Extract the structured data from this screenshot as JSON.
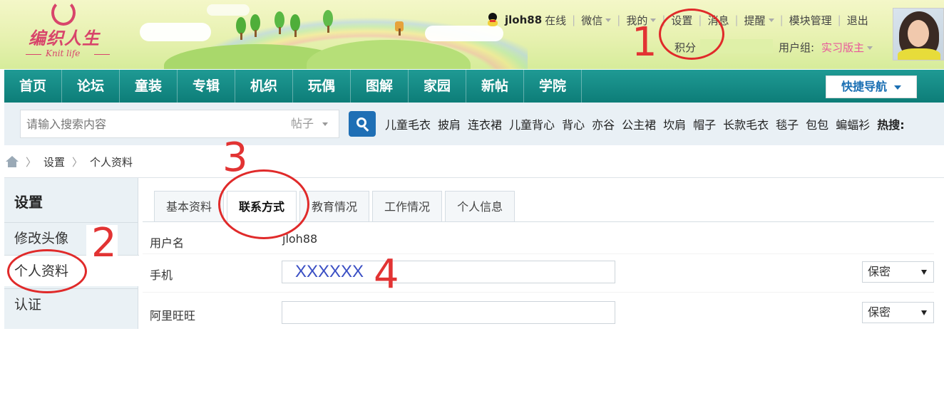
{
  "header": {
    "logo": {
      "cn": "编织人生",
      "en": "Knit life"
    },
    "topbar": {
      "username": "jloh88",
      "status": "在线",
      "links": [
        "微信",
        "我的",
        "设置",
        "消息",
        "提醒",
        "模块管理",
        "退出"
      ],
      "dropdown_links": [
        "微信",
        "我的",
        "提醒"
      ]
    },
    "points_label": "积分",
    "usergroup_label": "用户组:",
    "usergroup_value": "实习版主"
  },
  "nav": {
    "items": [
      "首页",
      "论坛",
      "童装",
      "专辑",
      "机织",
      "玩偶",
      "图解",
      "家园",
      "新帖",
      "学院"
    ],
    "quick_nav": "快捷导航"
  },
  "search": {
    "placeholder": "请输入搜索内容",
    "type": "帖子",
    "button_glyph": "搜",
    "hot_tags": [
      "儿童毛衣",
      "披肩",
      "连衣裙",
      "儿童背心",
      "背心",
      "亦谷",
      "公主裙",
      "坎肩",
      "帽子",
      "长款毛衣",
      "毯子",
      "包包",
      "蝙蝠衫"
    ],
    "hot_label": "热搜:"
  },
  "breadcrumb": {
    "items": [
      "设置",
      "个人资料"
    ],
    "separator": "〉"
  },
  "sidebar": {
    "title": "设置",
    "items": [
      {
        "label": "修改头像",
        "active": false
      },
      {
        "label": "个人资料",
        "active": true
      },
      {
        "label": "认证",
        "active": false
      }
    ]
  },
  "tabs": [
    {
      "label": "基本资料",
      "active": false
    },
    {
      "label": "联系方式",
      "active": true
    },
    {
      "label": "教育情况",
      "active": false
    },
    {
      "label": "工作情况",
      "active": false
    },
    {
      "label": "个人信息",
      "active": false
    }
  ],
  "form": {
    "username_label": "用户名",
    "username_value": "jloh88",
    "phone_label": "手机",
    "phone_value": "XXXXXX",
    "phone_privacy": "保密",
    "wangwang_label": "阿里旺旺",
    "wangwang_value": "",
    "wangwang_privacy": "保密"
  },
  "annotations": [
    "1",
    "2",
    "3",
    "4"
  ],
  "colors": {
    "nav_bg": "#0d7d78",
    "annotation_red": "#e02a2a",
    "role_pink": "#e8579a",
    "input_text": "#3a4fc4"
  }
}
